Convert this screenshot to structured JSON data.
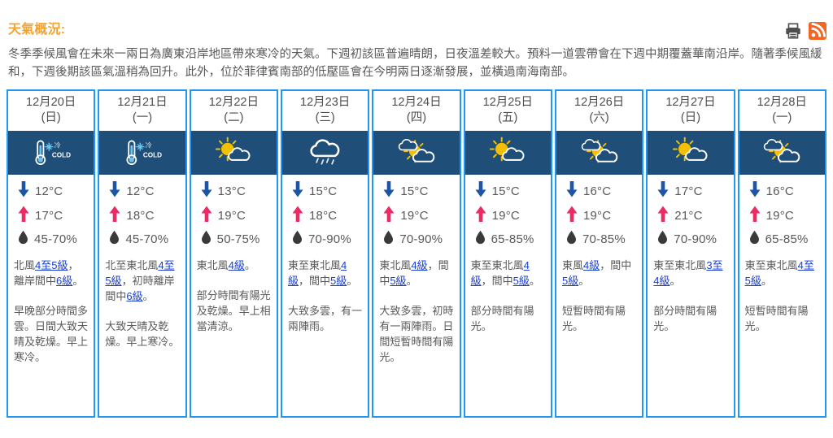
{
  "header": {
    "overview_title": "天氣概況:",
    "overview_text": "冬季季候風會在未來一兩日為廣東沿岸地區帶來寒冷的天氣。下週初該區普遍晴朗，日夜溫差較大。預料一道雲帶會在下週中期覆蓋華南沿岸。隨著季候風緩和，下週後期該區氣溫稍為回升。此外，位於菲律賓南部的低壓區會在今明兩日逐漸發展，並橫過南海南部。",
    "print_icon": "printer-icon",
    "rss_icon": "rss-icon"
  },
  "colors": {
    "title_orange": "#f5a32a",
    "rss_orange": "#f26522",
    "border_blue": "#2196f3",
    "icon_band": "#1f4e79",
    "min_arrow": "#1c54a8",
    "max_arrow": "#ec2b63",
    "link_blue": "#1a3fd0",
    "sun_yellow": "#f2c000",
    "text_grey": "#58595b"
  },
  "icons": {
    "min_temp": "arrow-down-icon",
    "max_temp": "arrow-up-icon",
    "humidity": "water-drop-icon"
  },
  "days": [
    {
      "date": "12月20日",
      "weekday": "(日)",
      "weather_icon": "cold-thermometer-icon",
      "weather_icon_label": "冷 COLD",
      "min_temp": "12°C",
      "max_temp": "17°C",
      "humidity": "45-70%",
      "wind_parts": [
        {
          "t": "北風",
          "link": false
        },
        {
          "t": "4至5級",
          "link": true
        },
        {
          "t": "，離岸間中",
          "link": false
        },
        {
          "t": "6級",
          "link": true
        },
        {
          "t": "。",
          "link": false
        }
      ],
      "description": "早晚部分時間多雲。日間大致天晴及乾燥。早上寒冷。"
    },
    {
      "date": "12月21日",
      "weekday": "(一)",
      "weather_icon": "cold-thermometer-icon",
      "weather_icon_label": "冷 COLD",
      "min_temp": "12°C",
      "max_temp": "18°C",
      "humidity": "45-70%",
      "wind_parts": [
        {
          "t": "北至東北風",
          "link": false
        },
        {
          "t": "4至5級",
          "link": true
        },
        {
          "t": "，初時離岸間中",
          "link": false
        },
        {
          "t": "6級",
          "link": true
        },
        {
          "t": "。",
          "link": false
        }
      ],
      "description": "大致天晴及乾燥。早上寒冷。"
    },
    {
      "date": "12月22日",
      "weekday": "(二)",
      "weather_icon": "sunny-periods-icon",
      "weather_icon_label": "",
      "min_temp": "13°C",
      "max_temp": "19°C",
      "humidity": "50-75%",
      "wind_parts": [
        {
          "t": "東北風",
          "link": false
        },
        {
          "t": "4級",
          "link": true
        },
        {
          "t": "。",
          "link": false
        }
      ],
      "description": "部分時間有陽光及乾燥。早上相當清涼。"
    },
    {
      "date": "12月23日",
      "weekday": "(三)",
      "weather_icon": "cloud-rain-icon",
      "weather_icon_label": "",
      "min_temp": "15°C",
      "max_temp": "18°C",
      "humidity": "70-90%",
      "wind_parts": [
        {
          "t": "東至東北風",
          "link": false
        },
        {
          "t": "4級",
          "link": true
        },
        {
          "t": "，間中",
          "link": false
        },
        {
          "t": "5級",
          "link": true
        },
        {
          "t": "。",
          "link": false
        }
      ],
      "description": "大致多雲，有一兩陣雨。"
    },
    {
      "date": "12月24日",
      "weekday": "(四)",
      "weather_icon": "cloudy-sunny-intervals-icon",
      "weather_icon_label": "",
      "min_temp": "15°C",
      "max_temp": "19°C",
      "humidity": "70-90%",
      "wind_parts": [
        {
          "t": "東北風",
          "link": false
        },
        {
          "t": "4級",
          "link": true
        },
        {
          "t": "，間中",
          "link": false
        },
        {
          "t": "5級",
          "link": true
        },
        {
          "t": "。",
          "link": false
        }
      ],
      "description": "大致多雲，初時有一兩陣雨。日間短暫時間有陽光。"
    },
    {
      "date": "12月25日",
      "weekday": "(五)",
      "weather_icon": "sunny-periods-icon",
      "weather_icon_label": "",
      "min_temp": "15°C",
      "max_temp": "19°C",
      "humidity": "65-85%",
      "wind_parts": [
        {
          "t": "東至東北風",
          "link": false
        },
        {
          "t": "4級",
          "link": true
        },
        {
          "t": "，間中",
          "link": false
        },
        {
          "t": "5級",
          "link": true
        },
        {
          "t": "。",
          "link": false
        }
      ],
      "description": "部分時間有陽光。"
    },
    {
      "date": "12月26日",
      "weekday": "(六)",
      "weather_icon": "cloudy-sunny-intervals-icon",
      "weather_icon_label": "",
      "min_temp": "16°C",
      "max_temp": "19°C",
      "humidity": "70-85%",
      "wind_parts": [
        {
          "t": "東風",
          "link": false
        },
        {
          "t": "4級",
          "link": true
        },
        {
          "t": "，間中",
          "link": false
        },
        {
          "t": "5級",
          "link": true
        },
        {
          "t": "。",
          "link": false
        }
      ],
      "description": "短暫時間有陽光。"
    },
    {
      "date": "12月27日",
      "weekday": "(日)",
      "weather_icon": "sunny-periods-icon",
      "weather_icon_label": "",
      "min_temp": "17°C",
      "max_temp": "21°C",
      "humidity": "70-90%",
      "wind_parts": [
        {
          "t": "東至東北風",
          "link": false
        },
        {
          "t": "3至4級",
          "link": true
        },
        {
          "t": "。",
          "link": false
        }
      ],
      "description": "部分時間有陽光。"
    },
    {
      "date": "12月28日",
      "weekday": "(一)",
      "weather_icon": "cloudy-sunny-intervals-icon",
      "weather_icon_label": "",
      "min_temp": "16°C",
      "max_temp": "19°C",
      "humidity": "65-85%",
      "wind_parts": [
        {
          "t": "東至東北風",
          "link": false
        },
        {
          "t": "4至5級",
          "link": true
        },
        {
          "t": "。",
          "link": false
        }
      ],
      "description": "短暫時間有陽光。"
    }
  ]
}
